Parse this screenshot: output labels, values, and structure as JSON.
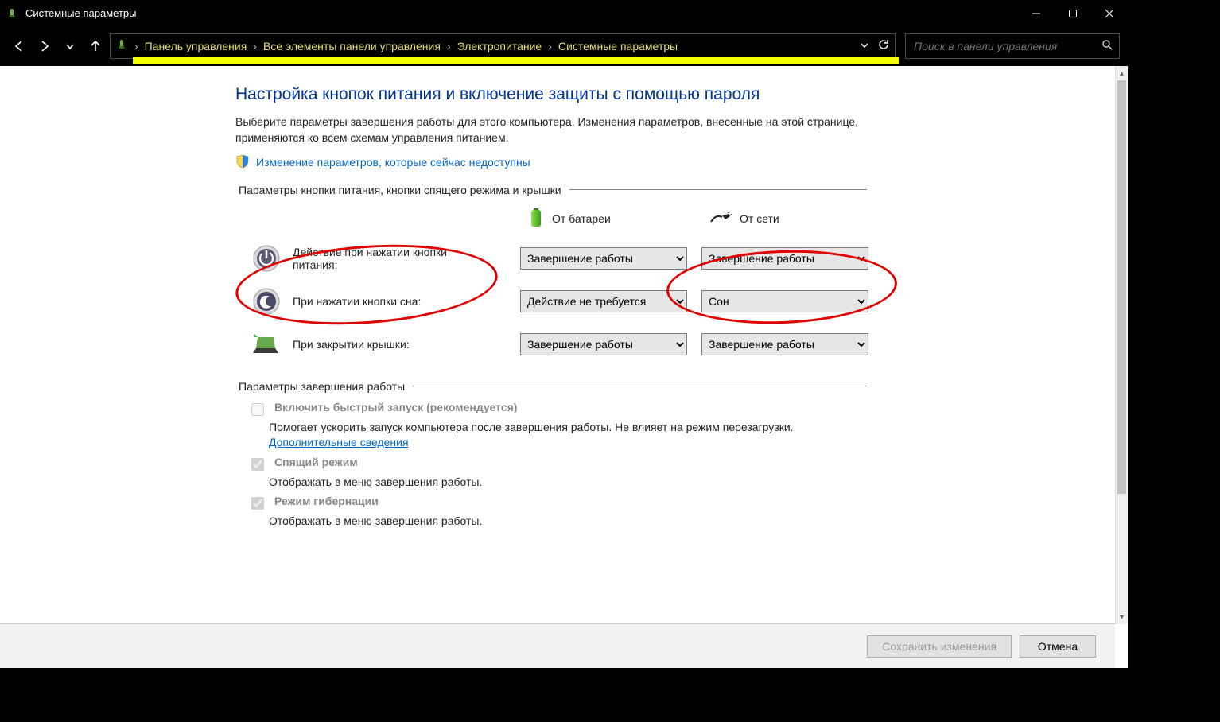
{
  "window": {
    "title": "Системные параметры"
  },
  "breadcrumbs": {
    "items": [
      "Панель управления",
      "Все элементы панели управления",
      "Электропитание",
      "Системные параметры"
    ]
  },
  "search": {
    "placeholder": "Поиск в панели управления"
  },
  "page": {
    "heading": "Настройка кнопок питания и включение защиты с помощью пароля",
    "lead": "Выберите параметры завершения работы для этого компьютера. Изменения параметров, внесенные на этой странице, применяются ко всем схемам управления питанием.",
    "change_link": "Изменение параметров, которые сейчас недоступны"
  },
  "sections": {
    "buttons_head": "Параметры кнопки питания, кнопки спящего режима и крышки",
    "shutdown_head": "Параметры завершения работы"
  },
  "columns": {
    "battery": "От батареи",
    "plugged": "От сети"
  },
  "rows": {
    "power_btn": "Действие при нажатии кнопки питания:",
    "sleep_btn": "При нажатии кнопки сна:",
    "lid": "При закрытии крышки:"
  },
  "selects": {
    "power_battery": "Завершение работы",
    "power_plugged": "Завершение работы",
    "sleep_battery": "Действие не требуется",
    "sleep_plugged": "Сон",
    "lid_battery": "Завершение работы",
    "lid_plugged": "Завершение работы"
  },
  "shutdown_opts": {
    "fast_start_label": "Включить быстрый запуск (рекомендуется)",
    "fast_start_desc_a": "Помогает ускорить запуск компьютера после завершения работы. Не влияет на режим перезагрузки. ",
    "fast_start_more": "Дополнительные сведения",
    "sleep_label": "Спящий режим",
    "sleep_desc": "Отображать в меню завершения работы.",
    "hibernate_label": "Режим гибернации",
    "hibernate_desc": "Отображать в меню завершения работы."
  },
  "footer": {
    "save": "Сохранить изменения",
    "cancel": "Отмена"
  }
}
